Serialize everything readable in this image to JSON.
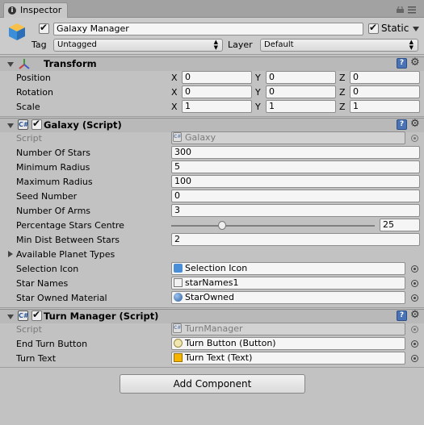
{
  "window": {
    "tab_title": "Inspector",
    "tab_icon": "info-icon"
  },
  "gameobject": {
    "active": true,
    "name": "Galaxy Manager",
    "static_label": "Static",
    "static": true,
    "tag_label": "Tag",
    "tag_value": "Untagged",
    "layer_label": "Layer",
    "layer_value": "Default"
  },
  "transform": {
    "title": "Transform",
    "rows": [
      {
        "label": "Position",
        "x": "0",
        "y": "0",
        "z": "0"
      },
      {
        "label": "Rotation",
        "x": "0",
        "y": "0",
        "z": "0"
      },
      {
        "label": "Scale",
        "x": "1",
        "y": "1",
        "z": "1"
      }
    ],
    "axis_x": "X",
    "axis_y": "Y",
    "axis_z": "Z"
  },
  "galaxy": {
    "title": "Galaxy (Script)",
    "enabled": true,
    "script_label": "Script",
    "script_value": "Galaxy",
    "fields": [
      {
        "label": "Number Of Stars",
        "value": "300"
      },
      {
        "label": "Minimum Radius",
        "value": "5"
      },
      {
        "label": "Maximum Radius",
        "value": "100"
      },
      {
        "label": "Seed Number",
        "value": "0"
      },
      {
        "label": "Number Of Arms",
        "value": "3"
      }
    ],
    "slider": {
      "label": "Percentage Stars Centre",
      "value": "25",
      "fraction": 0.25
    },
    "min_dist": {
      "label": "Min Dist Between Stars",
      "value": "2"
    },
    "planet_types_label": "Available Planet Types",
    "refs": [
      {
        "label": "Selection Icon",
        "value": "Selection Icon",
        "icon": "prefab-icon"
      },
      {
        "label": "Star Names",
        "value": "starNames1",
        "icon": "text-asset-icon"
      },
      {
        "label": "Star Owned Material",
        "value": "StarOwned",
        "icon": "material-icon"
      }
    ]
  },
  "turn_manager": {
    "title": "Turn Manager (Script)",
    "enabled": true,
    "script_label": "Script",
    "script_value": "TurnManager",
    "refs": [
      {
        "label": "End Turn Button",
        "value": "Turn Button (Button)",
        "icon": "button-icon"
      },
      {
        "label": "Turn Text",
        "value": "Turn Text (Text)",
        "icon": "text-icon"
      }
    ]
  },
  "add_component_label": "Add Component",
  "colors": {
    "background": "#c2c2c2",
    "header": "#b9b9b9",
    "help": "#4a73b5"
  }
}
